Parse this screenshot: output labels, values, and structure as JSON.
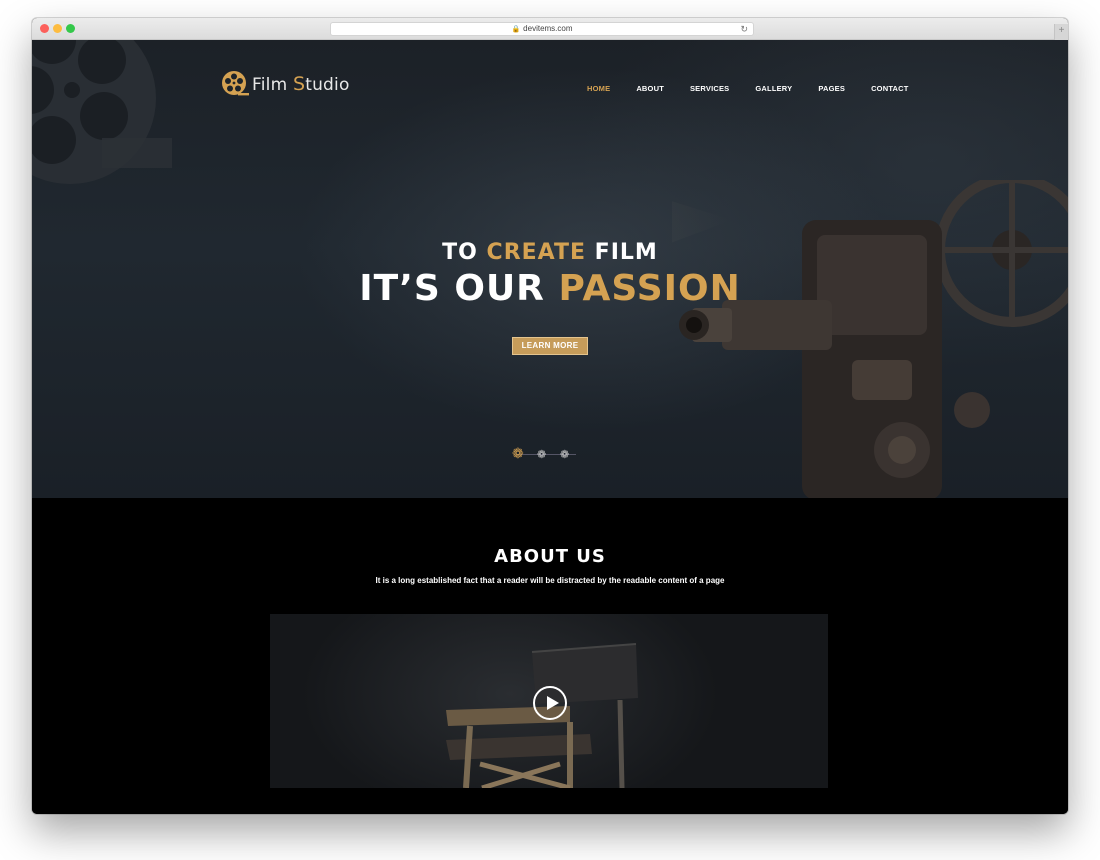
{
  "browser": {
    "url": "devitems.com"
  },
  "header": {
    "logo_main": "Film ",
    "logo_accent": "S",
    "logo_rest": "tudio",
    "nav": [
      {
        "label": "HOME"
      },
      {
        "label": "ABOUT"
      },
      {
        "label": "SERVICES"
      },
      {
        "label": "GALLERY"
      },
      {
        "label": "PAGES"
      },
      {
        "label": "CONTACT"
      }
    ]
  },
  "hero": {
    "line1_a": "TO ",
    "line1_b": "CREATE",
    "line1_c": " FILM",
    "line2_a": "IT’S OUR ",
    "line2_b": "PASSION",
    "cta": "LEARN MORE",
    "slide_count": 3,
    "active_slide": 1
  },
  "about": {
    "title": "ABOUT US",
    "subtitle": "It is a long established fact that a reader will be distracted by the readable content of a page"
  },
  "colors": {
    "accent": "#d5a252",
    "button": "#c69c5a"
  }
}
